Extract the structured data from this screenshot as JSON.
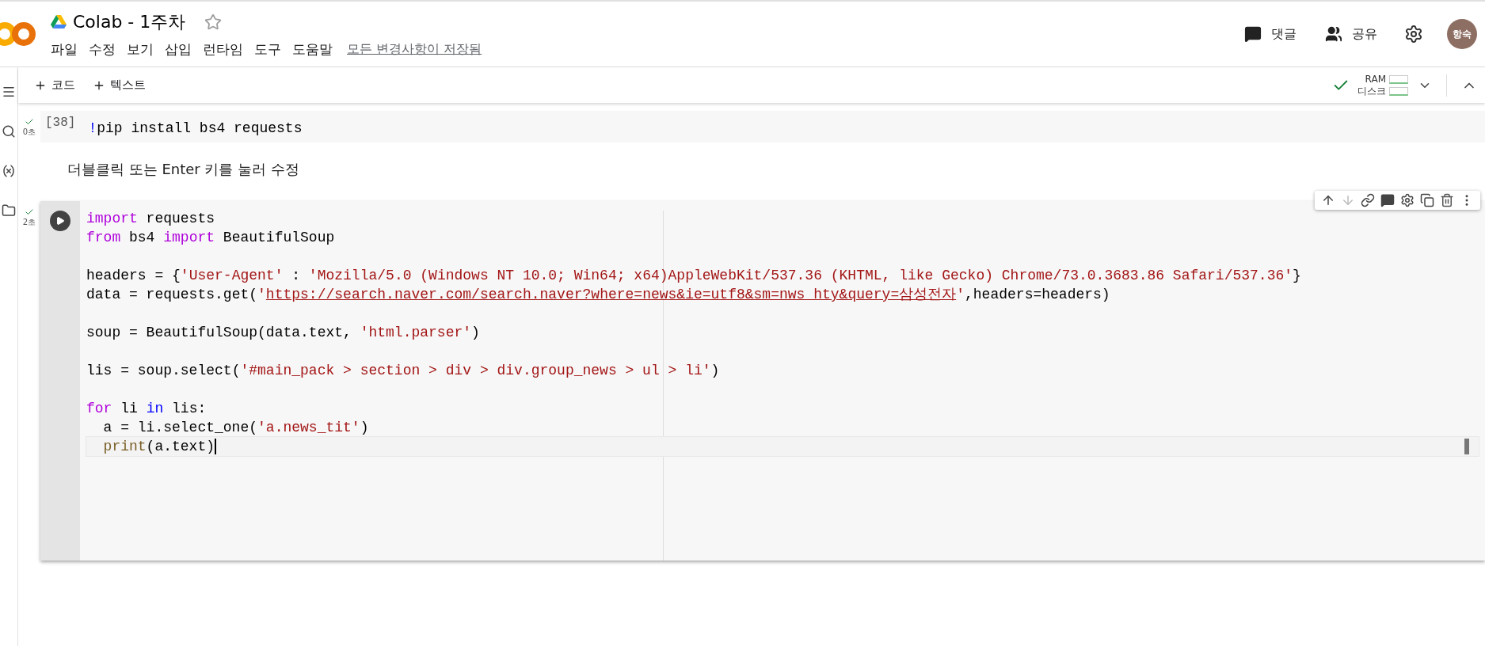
{
  "notebook": {
    "title": "Colab - 1주차",
    "starred": false,
    "menu": [
      "파일",
      "수정",
      "보기",
      "삽입",
      "런타임",
      "도구",
      "도움말"
    ],
    "save_status": "모든 변경사항이 저장됨"
  },
  "header_actions": {
    "comment": "댓글",
    "share": "공유",
    "avatar": "항숙"
  },
  "toolbar": {
    "add_code": "코드",
    "add_text": "텍스트",
    "runtime_connected": true,
    "ram_label": "RAM",
    "disk_label": "디스크"
  },
  "cells": [
    {
      "kind": "code",
      "count": "[38]",
      "done": true,
      "time": "0초",
      "focused": false,
      "lines": [
        {
          "kind": "code",
          "tokens": [
            {
              "t": "!",
              "kind": "op"
            },
            {
              "t": "pip install bs4 requests",
              "kind": "plain"
            }
          ]
        }
      ]
    },
    {
      "kind": "text",
      "text": "더블클릭 또는 Enter 키를 눌러 수정"
    },
    {
      "kind": "code",
      "done": true,
      "time": "2초",
      "focused": true,
      "lines": [
        {
          "kind": "code",
          "tokens": [
            {
              "t": "import",
              "kind": "kw"
            },
            {
              "t": " requests",
              "kind": "plain"
            }
          ]
        },
        {
          "kind": "code",
          "tokens": [
            {
              "t": "from",
              "kind": "kw"
            },
            {
              "t": " bs4 ",
              "kind": "plain"
            },
            {
              "t": "import",
              "kind": "kw"
            },
            {
              "t": " BeautifulSoup",
              "kind": "plain"
            }
          ]
        },
        {
          "kind": "blank"
        },
        {
          "kind": "code",
          "tokens": [
            {
              "t": "headers = {",
              "kind": "plain"
            },
            {
              "t": "'User-Agent'",
              "kind": "str"
            },
            {
              "t": " : ",
              "kind": "plain"
            },
            {
              "t": "'Mozilla/5.0 (Windows NT 10.0; Win64; x64)AppleWebKit/537.36 (KHTML, like Gecko) Chrome/73.0.3683.86 Safari/537.36'",
              "kind": "str"
            },
            {
              "t": "}",
              "kind": "plain"
            }
          ]
        },
        {
          "kind": "code",
          "tokens": [
            {
              "t": "data = requests.get(",
              "kind": "plain"
            },
            {
              "t": "'",
              "kind": "str"
            },
            {
              "t": "https://search.naver.com/search.naver?where=news&ie=utf8&sm=nws_hty&query=삼성전자",
              "kind": "url"
            },
            {
              "t": "'",
              "kind": "str"
            },
            {
              "t": ",headers=headers)",
              "kind": "plain"
            }
          ]
        },
        {
          "kind": "blank"
        },
        {
          "kind": "code",
          "tokens": [
            {
              "t": "soup = BeautifulSoup(data.text, ",
              "kind": "plain"
            },
            {
              "t": "'html.parser'",
              "kind": "str"
            },
            {
              "t": ")",
              "kind": "plain"
            }
          ]
        },
        {
          "kind": "blank"
        },
        {
          "kind": "code",
          "tokens": [
            {
              "t": "lis = soup.select(",
              "kind": "plain"
            },
            {
              "t": "'#main_pack > section > div > div.group_news > ul > li'",
              "kind": "str"
            },
            {
              "t": ")",
              "kind": "plain"
            }
          ]
        },
        {
          "kind": "blank"
        },
        {
          "kind": "code",
          "tokens": [
            {
              "t": "for",
              "kind": "kw"
            },
            {
              "t": " li ",
              "kind": "plain"
            },
            {
              "t": "in",
              "kind": "op"
            },
            {
              "t": " lis:",
              "kind": "plain"
            }
          ]
        },
        {
          "kind": "code",
          "indent": true,
          "tokens": [
            {
              "t": "a = li.select_one(",
              "kind": "plain"
            },
            {
              "t": "'a.news_tit'",
              "kind": "str"
            },
            {
              "t": ")",
              "kind": "plain"
            }
          ]
        },
        {
          "kind": "current",
          "indent": true,
          "tokens": [
            {
              "t": "print",
              "kind": "fn"
            },
            {
              "t": "(a.text)",
              "kind": "plain"
            }
          ]
        }
      ]
    }
  ]
}
